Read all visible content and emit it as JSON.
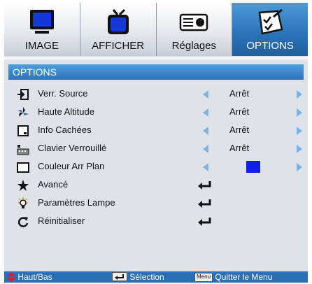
{
  "tabs": [
    {
      "label": "IMAGE",
      "icon": "monitor-icon",
      "active": false
    },
    {
      "label": "AFFICHER",
      "icon": "tv-icon",
      "active": false
    },
    {
      "label": "Réglages",
      "icon": "projector-icon",
      "active": false
    },
    {
      "label": "OPTIONS",
      "icon": "options-checklist-icon",
      "active": true
    }
  ],
  "section_title": "OPTIONS",
  "rows": [
    {
      "label": "Verr. Source",
      "icon": "source-input-icon",
      "value": "Arrêt"
    },
    {
      "label": "Haute Altitude",
      "icon": "fan-icon",
      "value": "Arrêt"
    },
    {
      "label": "Info Cachées",
      "icon": "hidden-info-icon",
      "value": "Arrêt"
    },
    {
      "label": "Clavier Verrouillé",
      "icon": "keypad-lock-icon",
      "value": "Arrêt"
    },
    {
      "label": "Couleur Arr Plan",
      "icon": "background-color-icon",
      "swatch_color": "#1020e8"
    },
    {
      "label": "Avancé",
      "icon": "advanced-star-icon"
    },
    {
      "label": "Paramètres Lampe",
      "icon": "lamp-icon"
    },
    {
      "label": "Réinitialiser",
      "icon": "reset-icon"
    }
  ],
  "footer": {
    "updown": "Haut/Bas",
    "select": "Sélection",
    "menu_key": "Menu",
    "quit": "Quitter le Menu"
  },
  "colors": {
    "accent": "#2d74bb",
    "arrow": "#7ab4e6",
    "updown_icon": "#e8182c"
  }
}
